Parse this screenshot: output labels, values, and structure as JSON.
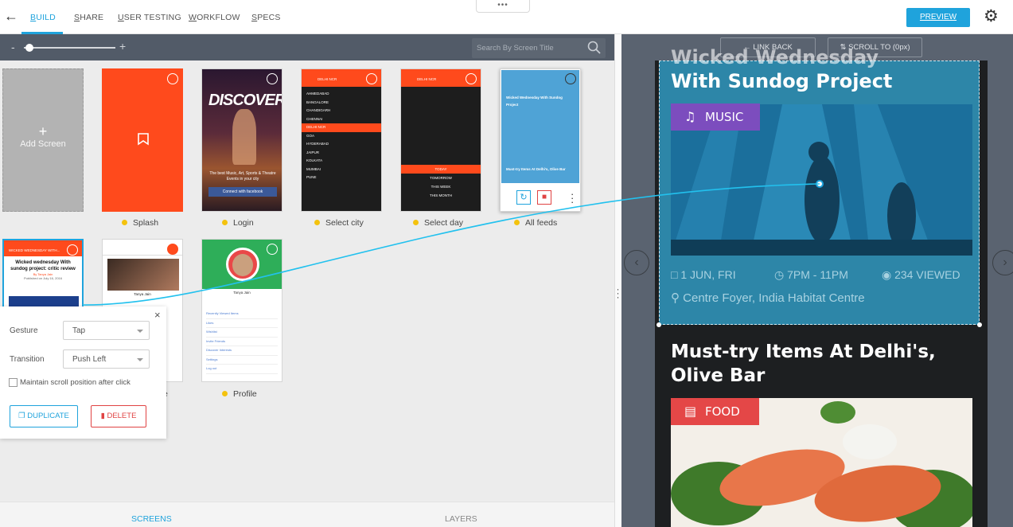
{
  "topbar": {
    "tabs": [
      {
        "label": "BUILD",
        "first": "B",
        "rest": "UILD"
      },
      {
        "label": "SHARE",
        "first": "S",
        "rest": "HARE"
      },
      {
        "label": "USER TESTING",
        "first": "U",
        "rest": "SER TESTING"
      },
      {
        "label": "WORKFLOW",
        "first": "W",
        "rest": "ORKFLOW"
      },
      {
        "label": "SPECS",
        "first": "S",
        "rest": "PECS"
      }
    ],
    "active_tab": "BUILD",
    "handle_dots": "•••",
    "preview_label": "PREVIEW"
  },
  "toolbar": {
    "zoom_minus": "-",
    "zoom_plus": "+",
    "zoom_level": 0.05,
    "search_placeholder": "Search By Screen Title"
  },
  "canvas": {
    "add_screen_plus": "+",
    "add_screen_label": "Add Screen",
    "screens": [
      {
        "label": "Splash"
      },
      {
        "label": "Login"
      },
      {
        "label": "Select city"
      },
      {
        "label": "Select day"
      },
      {
        "label": "All feeds"
      },
      {
        "label": "Profile"
      }
    ],
    "truncated_label_fragment": "e",
    "login_thumb": {
      "title": "DISCOVER",
      "tagline": "The best Music, Art, Sports & Theatre Events in your city",
      "fb_button": "Connect with facebook"
    },
    "city_thumb": {
      "header": "DELHI NCR",
      "cities": [
        "AHMEDABAD",
        "BANGALORE",
        "CHANDIGARH",
        "CHENNAI",
        "DELHI NCR",
        "GOA",
        "HYDERABAD",
        "JAIPUR",
        "KOLKATA",
        "MUMBAI",
        "PUNE"
      ]
    },
    "day_thumb": {
      "header": "DELHI NCR",
      "days": [
        "TODAY",
        "TOMORROW",
        "THIS WEEK",
        "THIS MONTH"
      ]
    },
    "feed_thumb": {
      "title": "Wicked Wednesday With Sundog Project",
      "title2": "Must-try Items At Delhi's, Olive Bar"
    },
    "article_thumb": {
      "header": "WICKED WEDNESDAY WITH...",
      "title": "Wicked wednesday With sundog project: critic review",
      "byline": "By Tanya Jain",
      "published": "Published on July 16, 2016"
    },
    "profile_thumb": {
      "name": "Tanya Jain",
      "menu": [
        "Recently Viewed Items",
        "Likes",
        "Wishlist",
        "Invite Friends",
        "Discover Interests",
        "Settings",
        "Log out"
      ]
    }
  },
  "popover": {
    "close": "×",
    "gesture_label": "Gesture",
    "gesture_value": "Tap",
    "transition_label": "Transition",
    "transition_value": "Push Left",
    "maintain_scroll_label": "Maintain scroll position after click",
    "maintain_scroll_checked": false,
    "duplicate_label": "DUPLICATE",
    "delete_label": "DELETE"
  },
  "bottom_tabs": {
    "screens": "SCREENS",
    "layers": "LAYERS",
    "active": "SCREENS"
  },
  "right_panel": {
    "link_back_label": "LINK BACK",
    "scroll_to_label": "SCROLL TO (0px)",
    "card1": {
      "title_line1": "Wicked Wednesday",
      "title_line2": "With Sundog Project",
      "tag": "MUSIC",
      "date": "1 JUN, FRI",
      "time": "7PM - 11PM",
      "views": "234 VIEWED",
      "venue": "Centre Foyer, India Habitat Centre"
    },
    "card2": {
      "title": "Must-try Items At Delhi's, Olive Bar",
      "tag": "FOOD"
    }
  },
  "colors": {
    "accent": "#1fa3dc",
    "toolbar": "#525b68",
    "splash_orange": "#ff4a1c",
    "delete_red": "#e04343",
    "dot_yellow": "#f4c20d",
    "music_tag": "#7c4dbe",
    "food_tag": "#e44747",
    "link_highlight": "#2d86a8"
  }
}
